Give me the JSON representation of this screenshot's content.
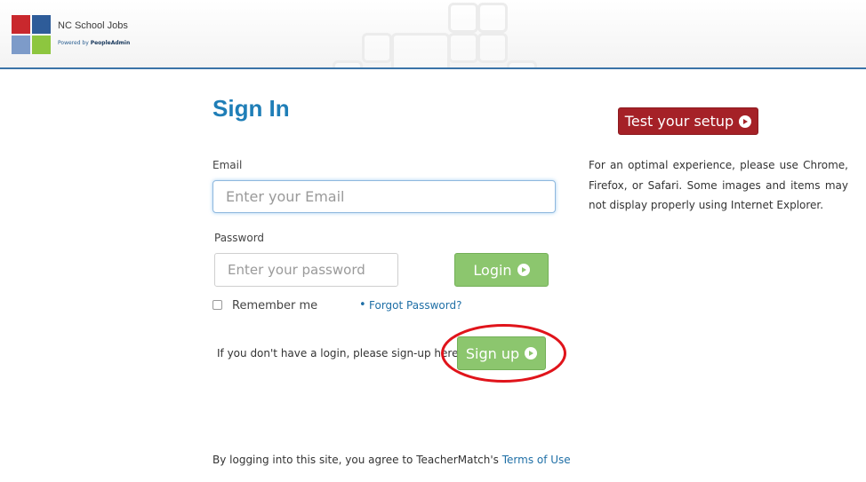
{
  "header": {
    "logo_title": "NC School Jobs",
    "logo_powered": "Powered by",
    "logo_brand": "PeopleAdmin"
  },
  "signin": {
    "title": "Sign In",
    "email_label": "Email",
    "email_placeholder": "Enter your Email",
    "password_label": "Password",
    "password_placeholder": "Enter your password",
    "login_button": "Login",
    "remember_label": "Remember me",
    "forgot_link": "Forgot Password?",
    "signup_prompt": "If you don't have a login, please sign-up here",
    "signup_button": "Sign up"
  },
  "sidebar": {
    "test_setup_button": "Test your setup",
    "browser_note": "For an optimal experience, please use Chrome, Firefox, or Safari. Some images and items may not display properly using Internet Explorer."
  },
  "footer": {
    "terms_prefix": "By logging into this site, you agree to TeacherMatch's",
    "terms_link": "Terms of Use"
  },
  "colors": {
    "heading": "#1f7eb7",
    "header_rule": "#3b74a8",
    "green_button": "#8cc66e",
    "red_button": "#a52127",
    "link": "#1f6fa6",
    "annotation": "#e0141b"
  },
  "icons": [
    "play-circle-icon",
    "logo-mark"
  ]
}
